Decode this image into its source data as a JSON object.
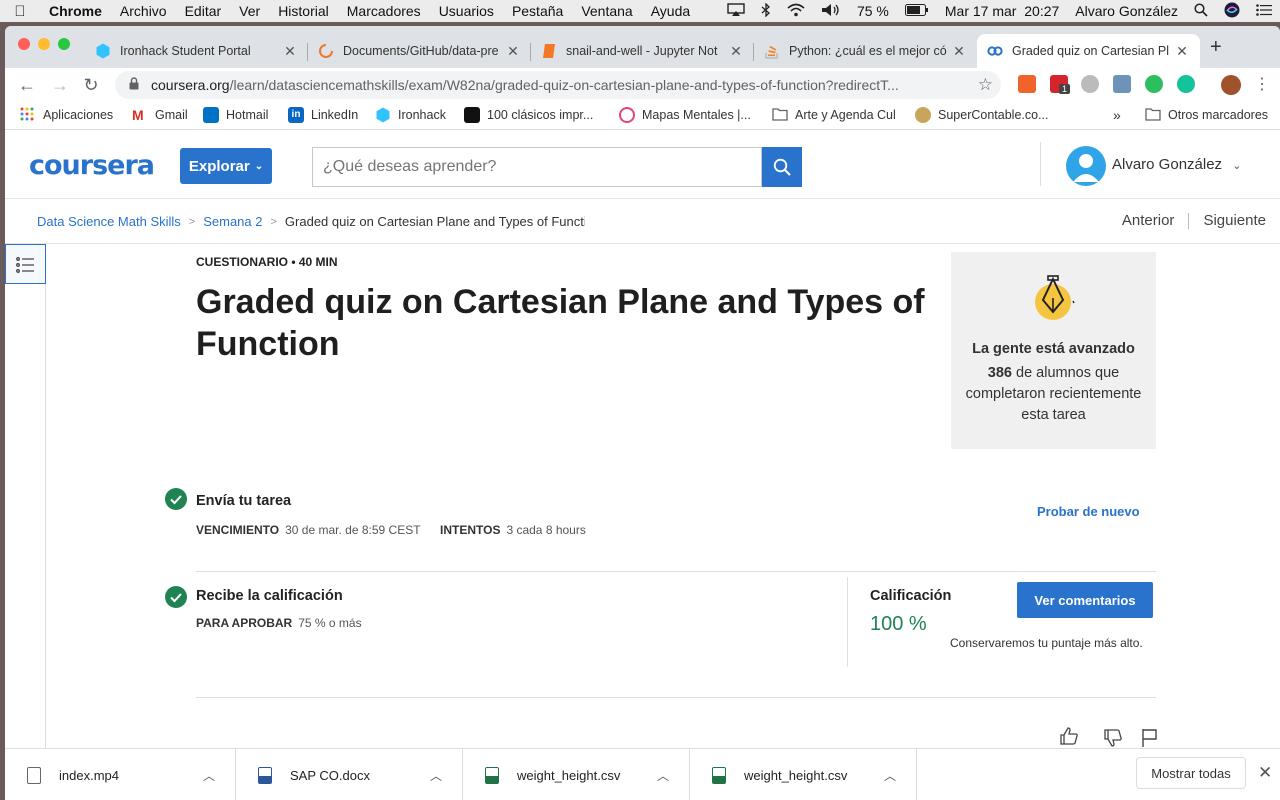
{
  "os_menubar": {
    "app_name": "Chrome",
    "menus": [
      "Archivo",
      "Editar",
      "Ver",
      "Historial",
      "Marcadores",
      "Usuarios",
      "Pestaña",
      "Ventana",
      "Ayuda"
    ],
    "battery": "75 %",
    "datetime": "Mar 17 mar  20:27",
    "user": "Alvaro González"
  },
  "browser": {
    "tabs": [
      {
        "title": "Ironhack Student Portal",
        "icon": "ironhack-icon",
        "active": false
      },
      {
        "title": "Documents/GitHub/data-pre",
        "icon": "jupyter-loading-icon",
        "active": false
      },
      {
        "title": "snail-and-well - Jupyter Not",
        "icon": "notebook-icon",
        "active": false
      },
      {
        "title": "Python: ¿cuál es el mejor có",
        "icon": "stackoverflow-icon",
        "active": false
      },
      {
        "title": "Graded quiz on Cartesian Pl",
        "icon": "coursera-icon",
        "active": true
      }
    ],
    "url_host": "coursera.org",
    "url_path": "/learn/datasciencemathskills/exam/W82na/graded-quiz-on-cartesian-plane-and-types-of-function?redirectT...",
    "extension_badge": "1",
    "bookmarks": [
      {
        "label": "Aplicaciones",
        "icon": "apps-grid-icon"
      },
      {
        "label": "Gmail",
        "icon": "gmail-icon"
      },
      {
        "label": "Hotmail",
        "icon": "outlook-icon"
      },
      {
        "label": "LinkedIn",
        "icon": "linkedin-icon"
      },
      {
        "label": "Ironhack",
        "icon": "ironhack-icon"
      },
      {
        "label": "100 clásicos impr...",
        "icon": "bookmark-icon"
      },
      {
        "label": "Mapas Mentales |...",
        "icon": "mindmap-icon"
      },
      {
        "label": "Arte y Agenda Cul",
        "icon": "folder-icon"
      },
      {
        "label": "SuperContable.co...",
        "icon": "supercontable-icon"
      }
    ],
    "other_bookmarks": "Otros marcadores"
  },
  "coursera": {
    "logo": "coursera",
    "explore_label": "Explorar",
    "search_placeholder": "¿Qué deseas aprender?",
    "user_name": "Alvaro González",
    "breadcrumbs": [
      "Data Science Math Skills",
      "Semana 2",
      "Graded quiz on Cartesian Plane and Types of Function"
    ],
    "prev_label": "Anterior",
    "next_label": "Siguiente",
    "kicker": "CUESTIONARIO • 40 MIN",
    "title": "Graded quiz on Cartesian Plane and Types of Function",
    "promo": {
      "title": "La gente está avanzado",
      "count": "386",
      "text": " de alumnos que completaron recientemente esta tarea"
    },
    "submit_step": {
      "title": "Envía tu tarea",
      "due_label": "VENCIMIENTO",
      "due_value": "30 de mar. de 8:59 CEST",
      "attempts_label": "INTENTOS",
      "attempts_value": "3 cada 8 hours",
      "retry_label": "Probar de nuevo"
    },
    "grade_step": {
      "title": "Recibe la calificación",
      "pass_label": "PARA APROBAR",
      "pass_value": "75 % o más",
      "grade_label": "Calificación",
      "grade_value": "100 %",
      "feedback_label": "Ver comentarios",
      "note": "Conservaremos tu puntaje más alto."
    }
  },
  "downloads": {
    "items": [
      {
        "name": "index.mp4",
        "icon": "video-file-icon"
      },
      {
        "name": "SAP CO.docx",
        "icon": "word-file-icon"
      },
      {
        "name": "weight_height.csv",
        "icon": "excel-file-icon"
      },
      {
        "name": "weight_height.csv",
        "icon": "excel-file-icon"
      }
    ],
    "show_all": "Mostrar todas"
  },
  "colors": {
    "coursera_blue": "#2a73cc",
    "success_green": "#1f8354"
  }
}
